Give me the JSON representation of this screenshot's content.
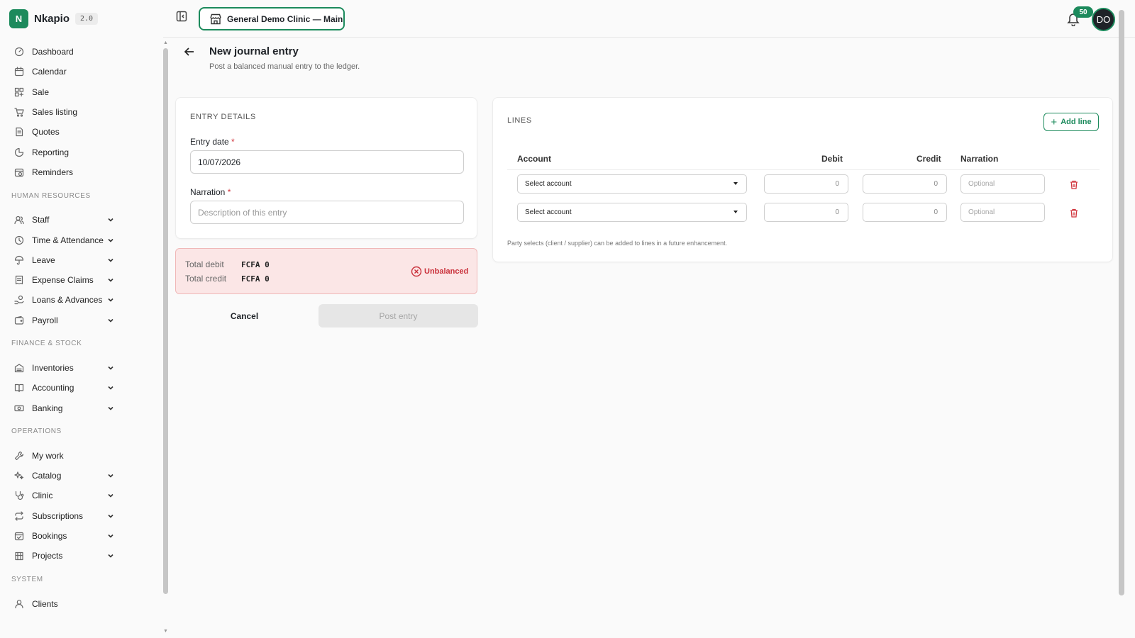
{
  "brand": {
    "logo_letter": "N",
    "name": "Nkapio",
    "version": "2.0"
  },
  "topbar": {
    "clinic_label": "General Demo Clinic — Main",
    "notifications_count": "50",
    "avatar_initials": "DO"
  },
  "sidebar": {
    "top_items": [
      {
        "label": "Dashboard",
        "icon": "dashboard-icon"
      },
      {
        "label": "Calendar",
        "icon": "calendar-icon"
      },
      {
        "label": "Sale",
        "icon": "sale-icon"
      },
      {
        "label": "Sales listing",
        "icon": "cart-icon"
      },
      {
        "label": "Quotes",
        "icon": "document-icon"
      },
      {
        "label": "Reporting",
        "icon": "pie-chart-icon"
      },
      {
        "label": "Reminders",
        "icon": "reminder-calendar-icon"
      }
    ],
    "sections": [
      {
        "title": "HUMAN RESOURCES",
        "items": [
          {
            "label": "Staff",
            "icon": "users-icon"
          },
          {
            "label": "Time & Attendance",
            "icon": "clock-icon"
          },
          {
            "label": "Leave",
            "icon": "umbrella-icon"
          },
          {
            "label": "Expense Claims",
            "icon": "receipt-icon"
          },
          {
            "label": "Loans & Advances",
            "icon": "hand-coin-icon"
          },
          {
            "label": "Payroll",
            "icon": "wallet-icon"
          }
        ]
      },
      {
        "title": "FINANCE & STOCK",
        "items": [
          {
            "label": "Inventories",
            "icon": "warehouse-icon"
          },
          {
            "label": "Accounting",
            "icon": "book-icon"
          },
          {
            "label": "Banking",
            "icon": "banknote-icon"
          }
        ]
      },
      {
        "title": "OPERATIONS",
        "items": [
          {
            "label": "My work",
            "icon": "wrench-icon",
            "no_chevron": true
          },
          {
            "label": "Catalog",
            "icon": "sparkles-icon"
          },
          {
            "label": "Clinic",
            "icon": "stethoscope-icon"
          },
          {
            "label": "Subscriptions",
            "icon": "repeat-icon"
          },
          {
            "label": "Bookings",
            "icon": "calendar-check-icon"
          },
          {
            "label": "Projects",
            "icon": "building-icon"
          }
        ]
      },
      {
        "title": "SYSTEM",
        "items": [
          {
            "label": "Clients",
            "icon": "user-icon",
            "no_chevron": true
          }
        ]
      }
    ]
  },
  "page": {
    "title": "New journal entry",
    "subtitle": "Post a balanced manual entry to the ledger."
  },
  "entry_details": {
    "heading": "ENTRY DETAILS",
    "date_label": "Entry date",
    "date_value": "10/07/2026",
    "narration_label": "Narration",
    "narration_placeholder": "Description of this entry",
    "required_mark": "*"
  },
  "totals": {
    "debit_label": "Total debit",
    "debit_value": "FCFA 0",
    "credit_label": "Total credit",
    "credit_value": "FCFA 0",
    "status": "Unbalanced"
  },
  "actions": {
    "cancel": "Cancel",
    "post": "Post entry"
  },
  "lines": {
    "heading": "LINES",
    "add_line": "Add line",
    "columns": {
      "account": "Account",
      "debit": "Debit",
      "credit": "Credit",
      "narration": "Narration"
    },
    "rows": [
      {
        "account": "Select account",
        "debit": "0",
        "credit": "0",
        "narration_placeholder": "Optional"
      },
      {
        "account": "Select account",
        "debit": "0",
        "credit": "0",
        "narration_placeholder": "Optional"
      }
    ],
    "note": "Party selects (client / supplier) can be added to lines in a future enhancement."
  },
  "colors": {
    "accent": "#1c8a5c",
    "danger": "#d0343c",
    "danger_bg": "#fbe6e6"
  }
}
